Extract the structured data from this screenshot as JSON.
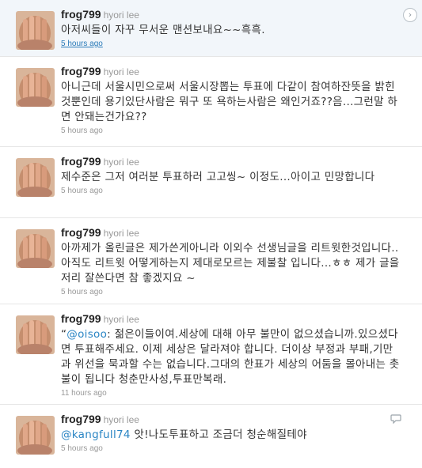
{
  "tweets": [
    {
      "user": "frog799",
      "name": "hyori lee",
      "text": "아저씨들이 자꾸 무서운 맨션보내요~~흑흑.",
      "time": "5 hours ago"
    },
    {
      "user": "frog799",
      "name": "hyori lee",
      "text": "아니근데 서울시민으로써 서울시장뽑는 투표에 다같이 참여하잔뜻을 밝힌것뿐인데 용기있단사람은 뭐구 또 욕하는사람은 왜인거죠??음...그런말 하면 안돼는건가요??",
      "time": "5 hours ago"
    },
    {
      "user": "frog799",
      "name": "hyori lee",
      "text": "제수준은 그저 여러분 투표하러 고고씽~ 이정도...아이고 민망합니다",
      "time": "5 hours ago"
    },
    {
      "user": "frog799",
      "name": "hyori lee",
      "text": "아까제가 올린글은 제가쓴게아니라 이외수 선생님글을 리트윗한것입니다.. 아직도 리트윗 어떻게하는지 제대로모르는 제불찰 입니다...ㅎㅎ 제가 글을 저리 잘쓴다면 참 좋겠지요 ~",
      "time": "5 hours ago"
    },
    {
      "user": "frog799",
      "name": "hyori lee",
      "text_prefix": "“",
      "mention": "@oisoo",
      "text": ": 젊은이들이여.세상에 대해 아무 불만이 없으셨습니까.있으셨다면 투표해주세요. 이제 세상은 달라져야 합니다. 더이상 부정과 부패,기만과 위선을 묵과할 수는 없습니다.그대의 한표가 세상의 어둠을 몰아내는 촛불이 됩니다 청춘만사성,투표만복래.",
      "time": "11 hours ago"
    },
    {
      "user": "frog799",
      "name": "hyori lee",
      "mention": "@kangfull74",
      "text": " 앗!나도투표하고 조금더 청순해질테야",
      "time": "5 hours ago"
    }
  ],
  "icons": {
    "details": "chevron-right-icon",
    "reply": "reply-icon"
  },
  "colors": {
    "link": "#2a85c4",
    "highlight": "#f2f6fa"
  }
}
